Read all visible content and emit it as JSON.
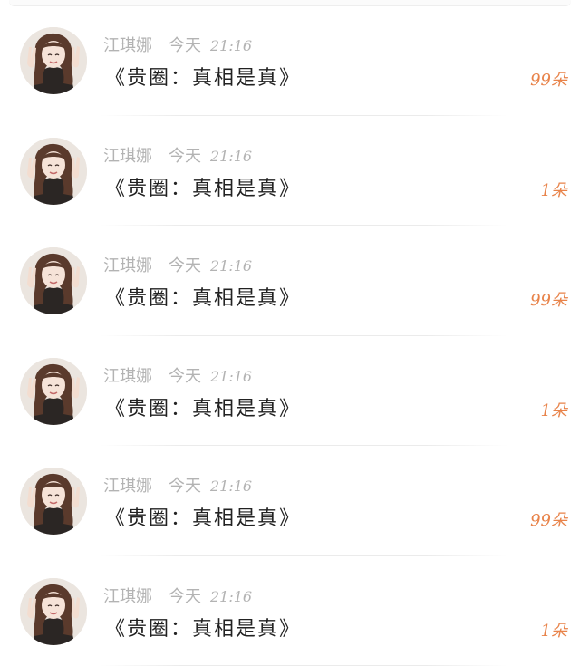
{
  "gift_list": {
    "items": [
      {
        "name": "江琪娜",
        "day": "今天",
        "time": "21:16",
        "title": "《贵圈：真相是真》",
        "gift": "99朵"
      },
      {
        "name": "江琪娜",
        "day": "今天",
        "time": "21:16",
        "title": "《贵圈：真相是真》",
        "gift": "1朵"
      },
      {
        "name": "江琪娜",
        "day": "今天",
        "time": "21:16",
        "title": "《贵圈：真相是真》",
        "gift": "99朵"
      },
      {
        "name": "江琪娜",
        "day": "今天",
        "time": "21:16",
        "title": "《贵圈：真相是真》",
        "gift": "1朵"
      },
      {
        "name": "江琪娜",
        "day": "今天",
        "time": "21:16",
        "title": "《贵圈：真相是真》",
        "gift": "99朵"
      },
      {
        "name": "江琪娜",
        "day": "今天",
        "time": "21:16",
        "title": "《贵圈：真相是真》",
        "gift": "1朵"
      }
    ]
  },
  "colors": {
    "gift_accent": "#e8834a",
    "meta_gray": "#b3b3b3",
    "title_text": "#222222"
  }
}
